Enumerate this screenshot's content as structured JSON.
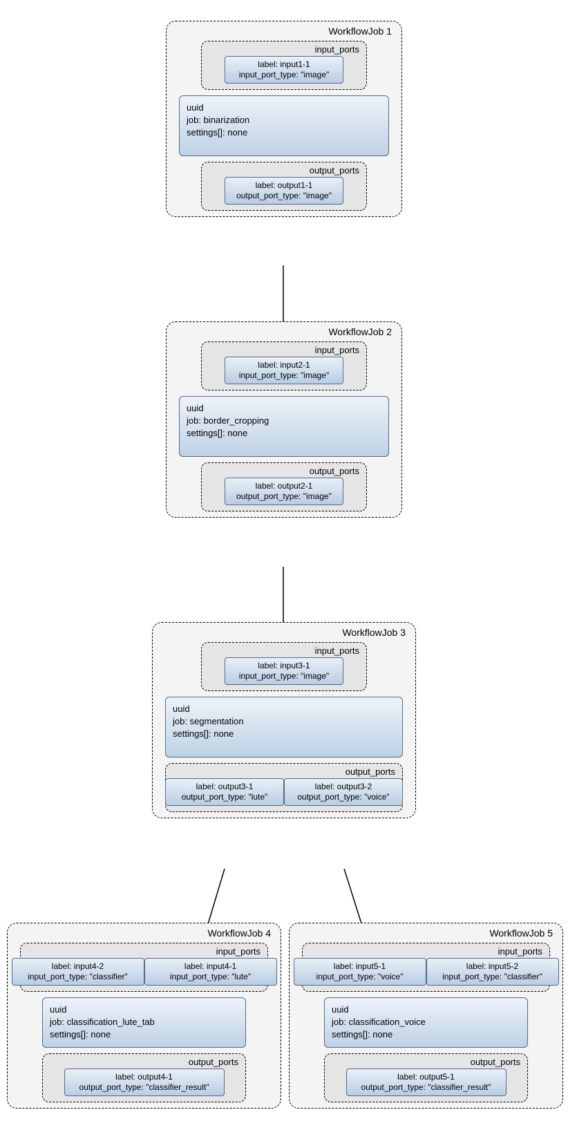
{
  "jobs": {
    "j1": {
      "title": "WorkflowJob 1",
      "inputs_title": "input_ports",
      "outputs_title": "output_ports",
      "inputs": [
        {
          "l1": "label: input1-1",
          "l2": "input_port_type: \"image\""
        }
      ],
      "body": {
        "l1": "uuid",
        "l2": "job: binarization",
        "l3": "settings[]: none"
      },
      "outputs": [
        {
          "l1": "label: output1-1",
          "l2": "output_port_type: \"image\""
        }
      ]
    },
    "j2": {
      "title": "WorkflowJob 2",
      "inputs_title": "input_ports",
      "outputs_title": "output_ports",
      "inputs": [
        {
          "l1": "label: input2-1",
          "l2": "input_port_type: \"image\""
        }
      ],
      "body": {
        "l1": "uuid",
        "l2": "job: border_cropping",
        "l3": "settings[]: none"
      },
      "outputs": [
        {
          "l1": "label: output2-1",
          "l2": "output_port_type: \"image\""
        }
      ]
    },
    "j3": {
      "title": "WorkflowJob 3",
      "inputs_title": "input_ports",
      "outputs_title": "output_ports",
      "inputs": [
        {
          "l1": "label: input3-1",
          "l2": "input_port_type: \"image\""
        }
      ],
      "body": {
        "l1": "uuid",
        "l2": "job: segmentation",
        "l3": "settings[]: none"
      },
      "outputs": [
        {
          "l1": "label: output3-1",
          "l2": "output_port_type: \"lute\""
        },
        {
          "l1": "label: output3-2",
          "l2": "output_port_type: \"voice\""
        }
      ]
    },
    "j4": {
      "title": "WorkflowJob 4",
      "inputs_title": "input_ports",
      "outputs_title": "output_ports",
      "inputs": [
        {
          "l1": "label: input4-2",
          "l2": "input_port_type: \"classifier\""
        },
        {
          "l1": "label: input4-1",
          "l2": "input_port_type: \"lute\""
        }
      ],
      "body": {
        "l1": "uuid",
        "l2": "job: classification_lute_tab",
        "l3": "settings[]: none"
      },
      "outputs": [
        {
          "l1": "label: output4-1",
          "l2": "output_port_type: \"classifier_result\""
        }
      ]
    },
    "j5": {
      "title": "WorkflowJob 5",
      "inputs_title": "input_ports",
      "outputs_title": "output_ports",
      "inputs": [
        {
          "l1": "label: input5-1",
          "l2": "input_port_type: \"voice\""
        },
        {
          "l1": "label: input5-2",
          "l2": "input_port_type: \"classifier\""
        }
      ],
      "body": {
        "l1": "uuid",
        "l2": "job: classification_voice",
        "l3": "settings[]: none"
      },
      "outputs": [
        {
          "l1": "label: output5-1",
          "l2": "output_port_type: \"classifier_result\""
        }
      ]
    }
  }
}
